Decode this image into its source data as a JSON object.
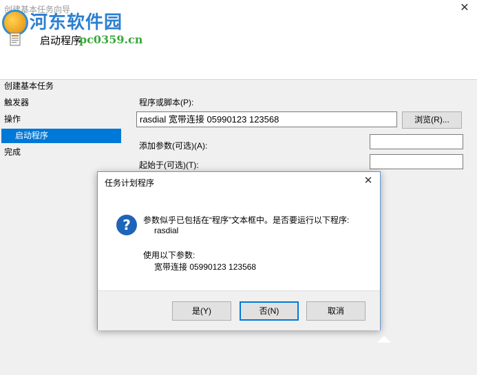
{
  "window": {
    "title": "创建基本任务向导",
    "page_title": "启动程序"
  },
  "watermark": {
    "brand": "河东软件园",
    "url": "pc0359.cn"
  },
  "steps": [
    {
      "label": "创建基本任务"
    },
    {
      "label": "触发器"
    },
    {
      "label": "操作"
    },
    {
      "label": "启动程序"
    },
    {
      "label": "完成"
    }
  ],
  "form": {
    "program_label": "程序或脚本(P):",
    "program_value": "rasdial 宽带连接 05990123 123568",
    "browse_label": "浏览(R)...",
    "args_label": "添加参数(可选)(A):",
    "args_value": "",
    "start_label": "起始于(可选)(T):",
    "start_value": ""
  },
  "dialog": {
    "title": "任务计划程序",
    "message_line1": "参数似乎已包括在“程序”文本框中。是否要运行以下程序:",
    "program": "rasdial",
    "params_label": "使用以下参数:",
    "params": "宽带连接 05990123 123568",
    "icon_glyph": "?",
    "buttons": {
      "yes": "是(Y)",
      "no": "否(N)",
      "cancel": "取消"
    }
  },
  "icons": [
    "close-icon",
    "question-icon",
    "task-icon"
  ]
}
